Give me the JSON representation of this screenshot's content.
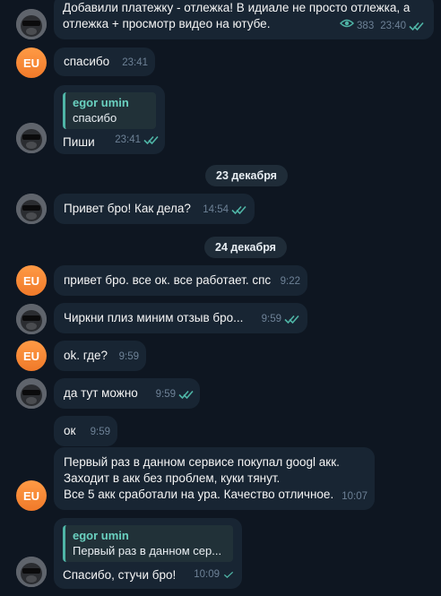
{
  "messages": [
    {
      "id": "m1",
      "lines": "Добавили платежку - отлежка! В идиале не просто отлежка, а\nотлежка + просмотр видео на ютубе.",
      "views": "383",
      "time": "23:40",
      "read": true
    },
    {
      "id": "m2",
      "text": "спасибо",
      "time": "23:41"
    },
    {
      "id": "m3",
      "quote_name": "egor umin",
      "quote_text": "спасибо",
      "text": "Пиши",
      "time": "23:41",
      "read": true
    },
    {
      "id": "d1",
      "date": "23 декабря"
    },
    {
      "id": "m4",
      "text": "Привет бро! Как дела?",
      "time": "14:54",
      "read": true
    },
    {
      "id": "d2",
      "date": "24 декабря"
    },
    {
      "id": "m5",
      "text": "привет бро. все ок. все работает. спс",
      "time": "9:22"
    },
    {
      "id": "m6",
      "text": "Чиркни плиз миним отзыв бро...",
      "time": "9:59",
      "read": true
    },
    {
      "id": "m7",
      "text": "ok. где?",
      "time": "9:59"
    },
    {
      "id": "m8",
      "text": "да тут можно",
      "time": "9:59",
      "read": true
    },
    {
      "id": "m9",
      "text": "ок",
      "time": "9:59"
    },
    {
      "id": "m10",
      "lines": "Первый раз в данном сервисе покупал googl акк.\nЗаходит в акк без проблем, куки тянут.\nВсе 5 акк сработали на ура. Качество отличное.",
      "time": "10:07"
    },
    {
      "id": "m11",
      "quote_name": "egor umin",
      "quote_text": "Первый раз в данном сер...",
      "text": "Спасибо, стучи бро!",
      "time": "10:09",
      "read": true
    }
  ],
  "avatars": {
    "eu_initials": "EU"
  },
  "colors": {
    "background": "#0e1621",
    "bubble": "#182533",
    "accent_check": "#4fb5a6",
    "eu_avatar": "#f07a2a"
  }
}
